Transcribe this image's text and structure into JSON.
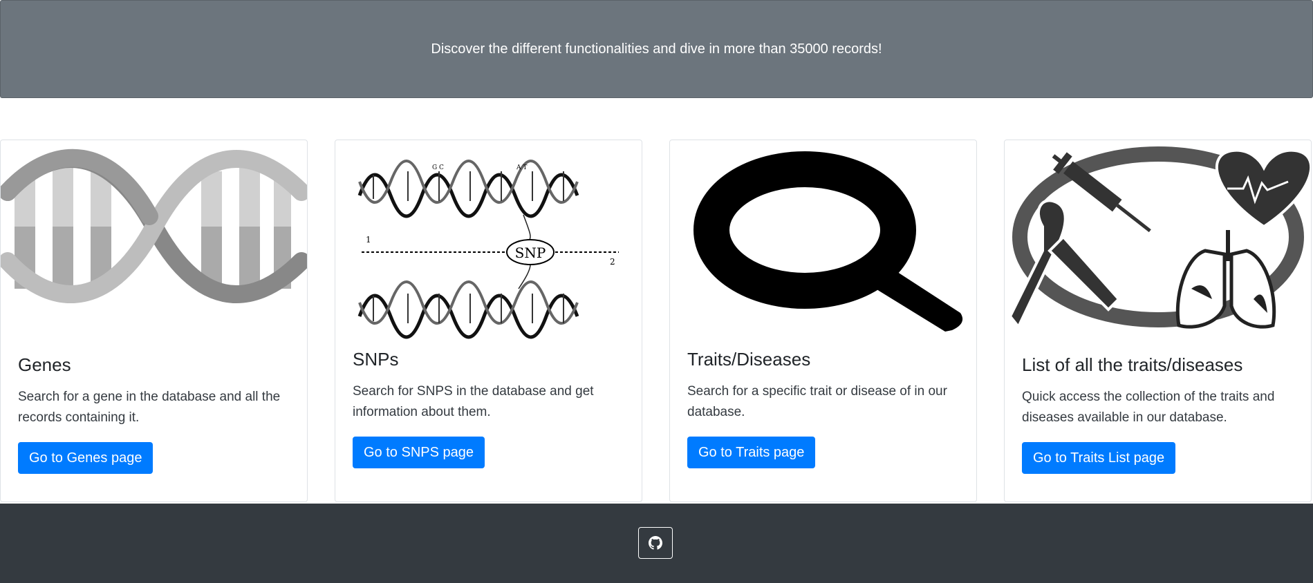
{
  "banner": {
    "text": "Discover the different functionalities and dive in more than 35000 records!"
  },
  "cards": [
    {
      "title": "Genes",
      "text": "Search for a gene in the database and all the records containing it.",
      "button": "Go to Genes page",
      "image": "dna-helix-icon"
    },
    {
      "title": "SNPs",
      "text": "Search for SNPS in the database and get information about them.",
      "button": "Go to SNPS page",
      "image": "snp-dna-illustration",
      "image_labels": {
        "snp": "SNP",
        "left": "1",
        "right": "2",
        "bases_a": "G C",
        "bases_b": "A T"
      }
    },
    {
      "title": "Traits/Diseases",
      "text": "Search for a specific trait or disease of in our database.",
      "button": "Go to Traits page",
      "image": "magnifying-glass-icon"
    },
    {
      "title": "List of all the traits/diseases",
      "text": "Quick access the collection of the traits and diseases available in our database.",
      "button": "Go to Traits List page",
      "image": "health-collage-icon"
    }
  ],
  "footer": {
    "icon": "github-icon"
  },
  "colors": {
    "banner": "#6c757d",
    "primary": "#007bff",
    "footer": "#343a40"
  }
}
